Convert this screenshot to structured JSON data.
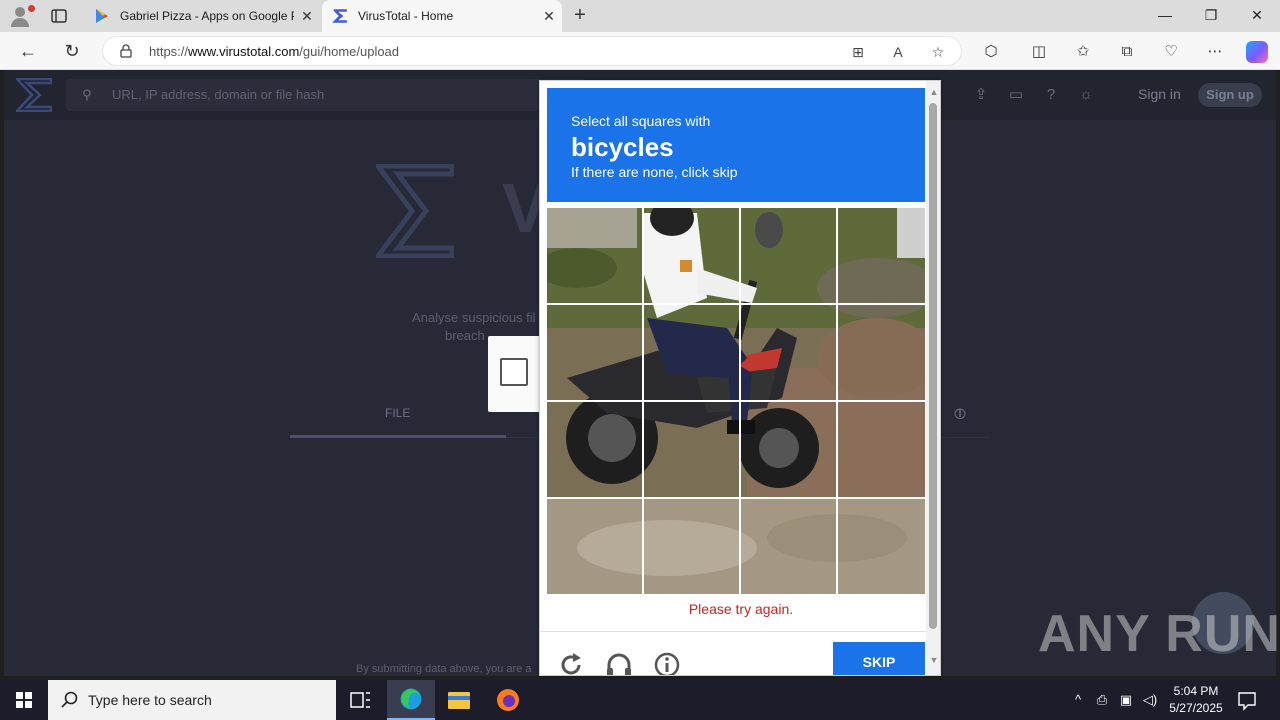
{
  "browser": {
    "tabs": [
      {
        "title": "Gabriel Pizza - Apps on Google P",
        "active": false
      },
      {
        "title": "VirusTotal - Home",
        "active": true
      }
    ],
    "url_prefix": "https://",
    "url_host": "www.virustotal.com",
    "url_path": "/gui/home/upload",
    "accent_color": "#1a73e8"
  },
  "virustotal": {
    "search_placeholder": "URL, IP address, domain or file hash",
    "sign_in": "Sign in",
    "sign_up": "Sign up",
    "brand_partial": "V",
    "description_line1": "Analyse suspicious fil",
    "description_line2": "breach",
    "tab_file": "FILE",
    "footer_partial": "By submitting data above, you are a"
  },
  "captcha": {
    "instruction": "Select all squares with",
    "target": "bicycles",
    "hint": "If there are none, click skip",
    "error": "Please try again.",
    "skip_label": "SKIP",
    "grid_rows": 4,
    "grid_cols": 4
  },
  "watermark": "ANY RUN",
  "taskbar": {
    "search_placeholder": "Type here to search",
    "time": "5:04 PM",
    "date": "5/27/2025"
  }
}
